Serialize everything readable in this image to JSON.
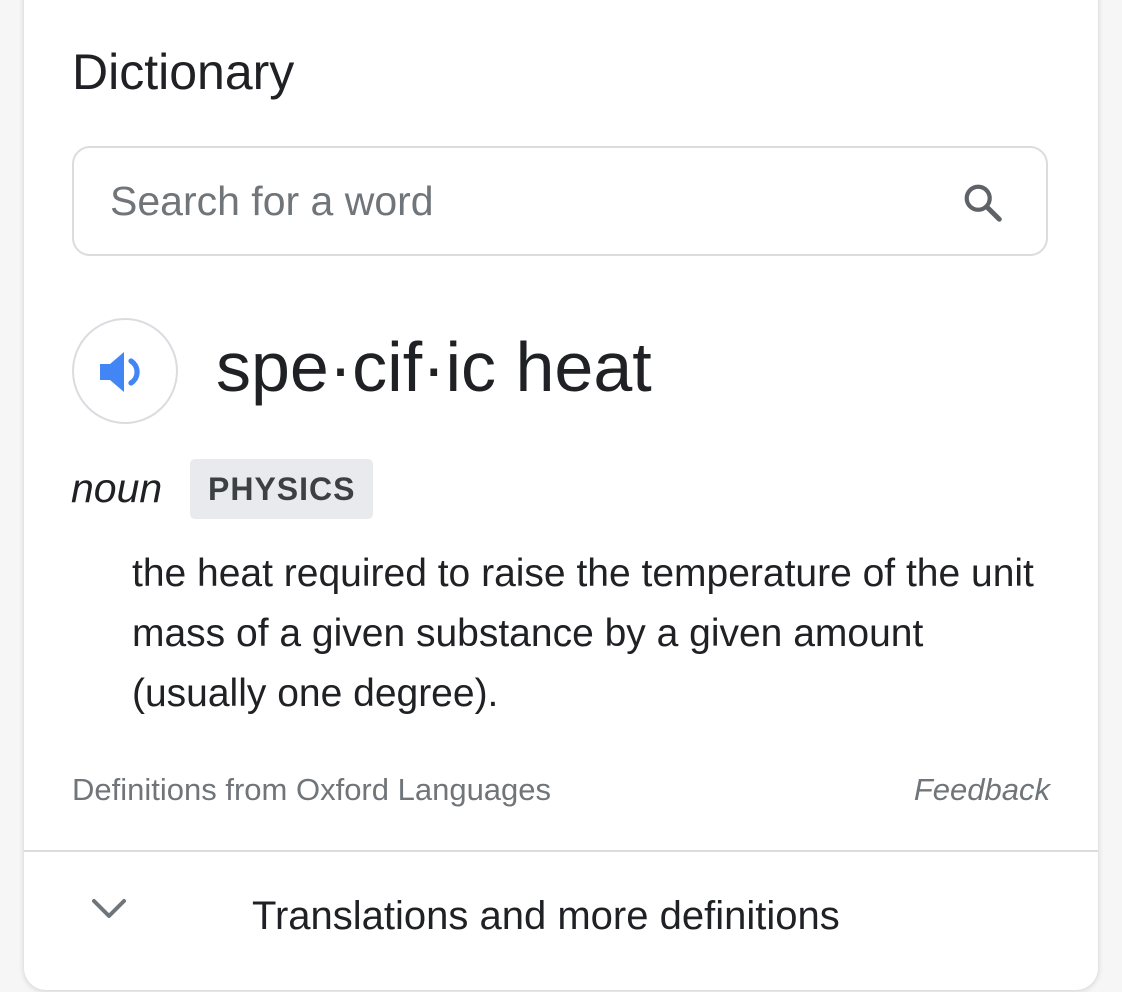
{
  "card": {
    "title": "Dictionary"
  },
  "search": {
    "placeholder": "Search for a word",
    "value": "",
    "icon": "search-icon"
  },
  "entry": {
    "audio_icon": "speaker-icon",
    "headword": "spe·cif·ic heat",
    "part_of_speech": "noun",
    "domain_label": "PHYSICS",
    "definition": "the heat required to raise the temperature of the unit mass of a given substance by a given amount (usually one degree)."
  },
  "footer": {
    "source": "Definitions from Oxford Languages",
    "feedback": "Feedback"
  },
  "more": {
    "icon": "chevron-down-icon",
    "label": "Translations and more definitions"
  },
  "colors": {
    "accent": "#4285f4",
    "text_primary": "#202124",
    "text_secondary": "#70757a",
    "border": "#dadce0",
    "badge_bg": "#e8eaed"
  }
}
